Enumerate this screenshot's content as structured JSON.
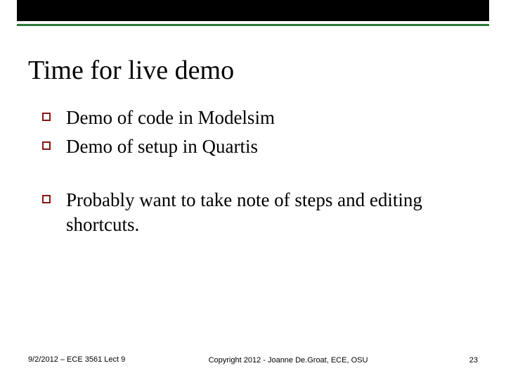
{
  "title": "Time for live demo",
  "bullets": [
    {
      "text": "Demo of code in Modelsim"
    },
    {
      "text": "Demo of setup in Quartis"
    },
    {
      "text": "Probably want to take note of steps and editing shortcuts."
    }
  ],
  "footer": {
    "left": "9/2/2012 – ECE 3561 Lect 9",
    "center": "Copyright 2012 - Joanne De.Groat, ECE, OSU",
    "right": "23"
  }
}
